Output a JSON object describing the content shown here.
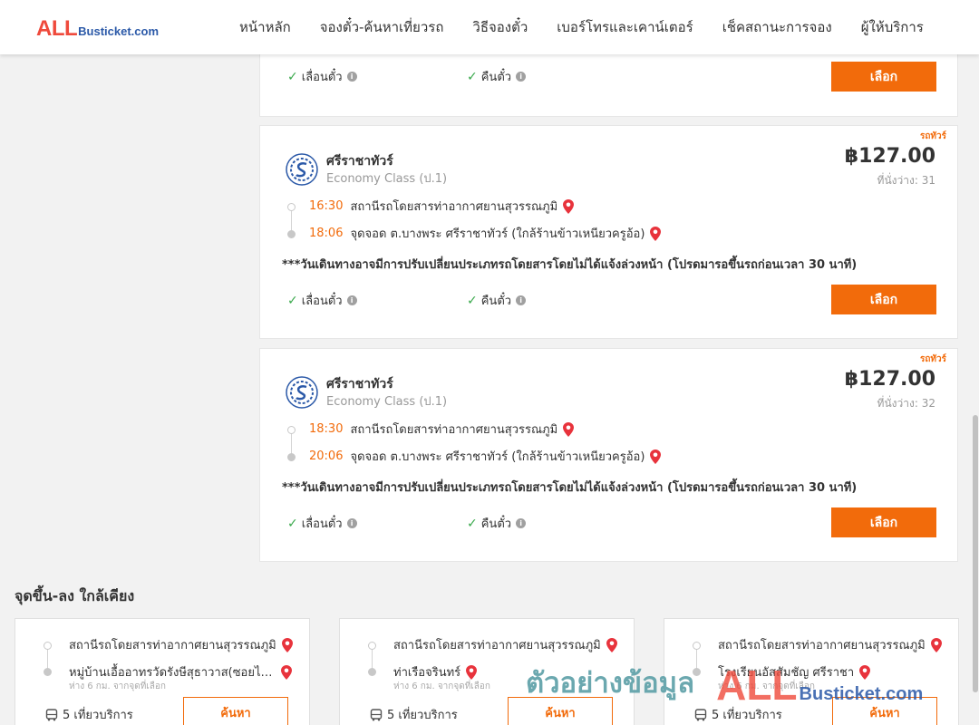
{
  "header": {
    "logo_all": "ALL",
    "logo_bus": "Busticket.com",
    "nav": [
      "หน้าหลัก",
      "จองตั๋ว-ค้นหาเที่ยวรถ",
      "วิธีจองตั๋ว",
      "เบอร์โทรและเคาน์เตอร์",
      "เช็คสถานะการจอง",
      "ผู้ให้บริการ"
    ]
  },
  "common": {
    "feature_reschedule": "เลื่อนตั๋ว",
    "feature_refund": "คืนตั๋ว",
    "select_label": "เลือก",
    "seats_label": "ที่นั่งว่าง:",
    "bus_type": "รถทัวร์"
  },
  "trips": [
    {
      "operator": "ศรีราชาทัวร์",
      "class": "Economy Class (ป.1)",
      "price": "฿127.00",
      "seats": "31",
      "depart_time": "16:30",
      "depart_place": "สถานีรถโดยสารท่าอากาศยานสุวรรณภูมิ",
      "arrive_time": "18:06",
      "arrive_place": "จุดจอด ต.บางพระ ศรีราชาทัวร์ (ใกล้ร้านข้าวเหนียวครูอ้อ)",
      "notice": "***วันเดินทางอาจมีการปรับเปลี่ยนประเภทรถโดยสารโดยไม่ได้แจ้งล่วงหน้า (โปรดมารอขึ้นรถก่อนเวลา 30 นาที)"
    },
    {
      "operator": "ศรีราชาทัวร์",
      "class": "Economy Class (ป.1)",
      "price": "฿127.00",
      "seats": "32",
      "depart_time": "18:30",
      "depart_place": "สถานีรถโดยสารท่าอากาศยานสุวรรณภูมิ",
      "arrive_time": "20:06",
      "arrive_place": "จุดจอด ต.บางพระ ศรีราชาทัวร์ (ใกล้ร้านข้าวเหนียวครูอ้อ)",
      "notice": "***วันเดินทางอาจมีการปรับเปลี่ยนประเภทรถโดยสารโดยไม่ได้แจ้งล่วงหน้า (โปรดมารอขึ้นรถก่อนเวลา 30 นาที)"
    }
  ],
  "nearby": {
    "title": "จุดขึ้น-ลง ใกล้เคียง",
    "search_label": "ค้นหา",
    "items": [
      {
        "from": "สถานีรถโดยสารท่าอากาศยานสุวรรณภูมิ",
        "to": "หมู่บ้านเอื้ออาทรวัดรังษีสุธาวาส(ซอยไทยงาม)",
        "distance": "ห่าง 6 กม. จากจุดที่เลือก",
        "trips": "5 เที่ยวบริการ"
      },
      {
        "from": "สถานีรถโดยสารท่าอากาศยานสุวรรณภูมิ",
        "to": "ท่าเรือจรินทร์",
        "distance": "ห่าง 6 กม. จากจุดที่เลือก",
        "trips": "5 เที่ยวบริการ"
      },
      {
        "from": "สถานีรถโดยสารท่าอากาศยานสุวรรณภูมิ",
        "to": "โรงเรียนอัสสัมชัญ ศรีราชา",
        "distance": "ห่าง 6 กม. จากจุดที่เลือก",
        "trips": "5 เที่ยวบริการ"
      }
    ]
  },
  "watermark": {
    "thai": "ตัวอย่างข้อมูล",
    "all": "ALL",
    "bus": "Busticket.com"
  },
  "colors": {
    "accent": "#f26b0b",
    "check": "#3aa94c",
    "logo_red": "#ef4a3c",
    "logo_blue": "#2b59a8"
  }
}
